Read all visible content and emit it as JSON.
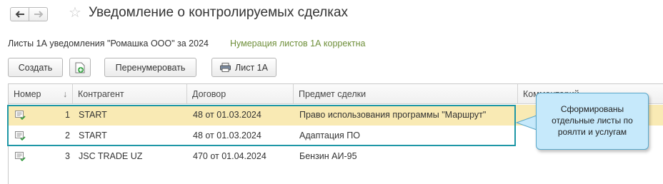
{
  "header": {
    "title": "Уведомление о контролируемых сделках"
  },
  "subtitle": "Листы 1А уведомления \"Ромашка ООО\" за 2024",
  "status_note": "Нумерация листов 1А корректна",
  "toolbar": {
    "create_label": "Создать",
    "renumber_label": "Перенумеровать",
    "print_label": "Лист 1А"
  },
  "table": {
    "columns": {
      "number": "Номер",
      "counterparty": "Контрагент",
      "contract": "Договор",
      "subject": "Предмет сделки",
      "comment": "Комментарий"
    },
    "rows": [
      {
        "number": "1",
        "counterparty": "START",
        "contract": "48 от 01.03.2024",
        "subject": "Право использования программы \"Маршрут\""
      },
      {
        "number": "2",
        "counterparty": "START",
        "contract": "48 от 01.03.2024",
        "subject": "Адаптация ПО"
      },
      {
        "number": "3",
        "counterparty": "JSC TRADE UZ",
        "contract": "470 от 01.04.2024",
        "subject": "Бензин АИ-95"
      }
    ]
  },
  "callout": {
    "text": "Сформированы отдельные листы по роялти и услугам"
  },
  "colors": {
    "accent_teal": "#1e97a6",
    "selected_row": "#f9eab4",
    "status_green": "#6f8f3a",
    "callout_bg": "#c6e9fb"
  }
}
